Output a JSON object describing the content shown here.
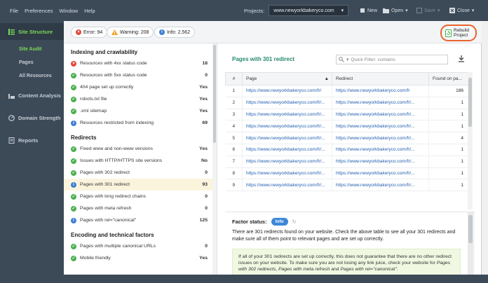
{
  "menu": {
    "file": "File",
    "preferences": "Preferences",
    "window": "Window",
    "help": "Help"
  },
  "project": {
    "label": "Projects:",
    "value": "www.newyorkbakeryco.com"
  },
  "toolbar": {
    "new": "New",
    "open": "Open",
    "save": "Save",
    "close": "Close"
  },
  "sidebar": {
    "items": [
      {
        "label": "Site Structure",
        "active": true
      },
      {
        "label": "Content Analysis",
        "active": false
      },
      {
        "label": "Domain Strength",
        "active": false
      },
      {
        "label": "Reports",
        "active": false
      }
    ],
    "subitems": [
      {
        "label": "Site Audit",
        "active": true
      },
      {
        "label": "Pages",
        "active": false
      },
      {
        "label": "All Resources",
        "active": false
      }
    ]
  },
  "summary": {
    "error": "Error: 94",
    "warning": "Warning: 208",
    "info": "Info: 2,562"
  },
  "rebuild": {
    "line1": "Rebuild",
    "line2": "Project"
  },
  "sections": [
    {
      "title": "Indexing and crawlability",
      "rows": [
        {
          "status": "error",
          "label": "Resources with 4xx status code",
          "value": "18"
        },
        {
          "status": "ok",
          "label": "Resources with 5xx status code",
          "value": "0"
        },
        {
          "status": "ok",
          "label": "404 page set up correctly",
          "value": "Yes"
        },
        {
          "status": "ok",
          "label": "robots.txt file",
          "value": "Yes"
        },
        {
          "status": "ok",
          "label": ".xml sitemap",
          "value": "Yes"
        },
        {
          "status": "info",
          "label": "Resources restricted from indexing",
          "value": "69"
        }
      ]
    },
    {
      "title": "Redirects",
      "rows": [
        {
          "status": "ok",
          "label": "Fixed www and non-www versions",
          "value": "Yes"
        },
        {
          "status": "ok",
          "label": "Issues with HTTP/HTTPS site versions",
          "value": "No"
        },
        {
          "status": "ok",
          "label": "Pages with 302 redirect",
          "value": "0"
        },
        {
          "status": "info",
          "label": "Pages with 301 redirect",
          "value": "93",
          "selected": true
        },
        {
          "status": "ok",
          "label": "Pages with long redirect chains",
          "value": "0"
        },
        {
          "status": "ok",
          "label": "Pages with meta refresh",
          "value": "0"
        },
        {
          "status": "info",
          "label": "Pages with rel=\"canonical\"",
          "value": "125"
        }
      ]
    },
    {
      "title": "Encoding and technical factors",
      "rows": [
        {
          "status": "ok",
          "label": "Pages with multiple canonical URLs",
          "value": "0"
        },
        {
          "status": "ok",
          "label": "Mobile friendly",
          "value": "Yes"
        }
      ]
    }
  ],
  "detail": {
    "title": "Pages with 301 redirect",
    "filter_placeholder": "Quick Filter: contains",
    "columns": [
      "#",
      "Page",
      "Redirect",
      "Found on pa..."
    ],
    "rows": [
      {
        "n": "1",
        "page": "https://www.newyorkbakeryco.com/fr/",
        "redirect": "https://www.newyorkbakeryco.com/fr",
        "found": "186"
      },
      {
        "n": "2",
        "page": "https://www.newyorkbakeryco.com/fr/...",
        "redirect": "https://www.newyorkbakeryco.com/fr/...",
        "found": "1"
      },
      {
        "n": "3",
        "page": "https://www.newyorkbakeryco.com/fr/...",
        "redirect": "https://www.newyorkbakeryco.com/fr/...",
        "found": "1"
      },
      {
        "n": "4",
        "page": "https://www.newyorkbakeryco.com/fr/...",
        "redirect": "https://www.newyorkbakeryco.com/fr/...",
        "found": "1"
      },
      {
        "n": "5",
        "page": "https://www.newyorkbakeryco.com/fr/...",
        "redirect": "https://www.newyorkbakeryco.com/fr/...",
        "found": "4"
      },
      {
        "n": "6",
        "page": "https://www.newyorkbakeryco.com/fr/...",
        "redirect": "https://www.newyorkbakeryco.com/fr/...",
        "found": "1"
      },
      {
        "n": "7",
        "page": "https://www.newyorkbakeryco.com/fr/...",
        "redirect": "https://www.newyorkbakeryco.com/fr/...",
        "found": "1"
      },
      {
        "n": "8",
        "page": "https://www.newyorkbakeryco.com/fr/...",
        "redirect": "https://www.newyorkbakeryco.com/fr/...",
        "found": "1"
      },
      {
        "n": "9",
        "page": "https://www.newyorkbakeryco.com/fr/...",
        "redirect": "https://www.newyorkbakeryco.com/fr/...",
        "found": "1"
      }
    ]
  },
  "factor": {
    "label": "Factor status:",
    "status": "Info",
    "description": "There are 301 redirects found on your website. Check the above table to see all your 301 redirects and make sure all of them point to relevant pages and are set up correctly.",
    "note_prefix": "If all of your 301 redirects are set up correctly, this does not guarantee that there are no other redirect issues on your website. To make sure you are not losing any link juice, check your website for ",
    "note_italic1": "Pages with 302 redirects",
    "note_sep1": ", ",
    "note_italic2": "Pages with meta refresh",
    "note_sep2": " and ",
    "note_italic3": "Pages with rel=\"canonical\"",
    "note_end": "."
  },
  "colors": {
    "ok": "#4caf50",
    "error": "#e24b3b",
    "info": "#3d7fd0",
    "warning": "#f0a020",
    "accent": "#7ed957",
    "highlight": "#e8642e"
  }
}
